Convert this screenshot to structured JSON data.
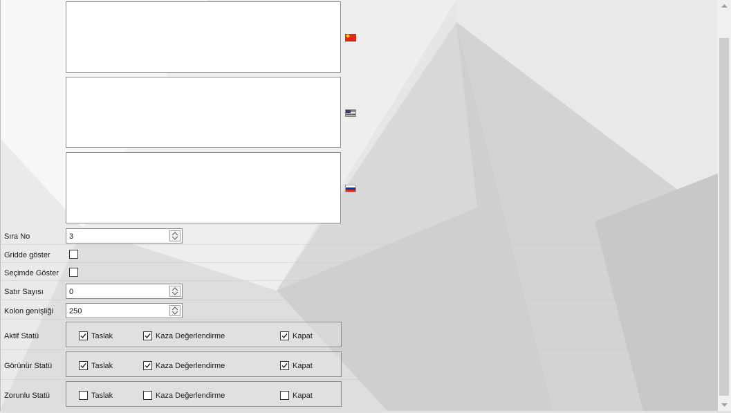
{
  "flags": [
    "china-flag",
    "usa-flag",
    "russia-flag"
  ],
  "fields": {
    "sira_no": {
      "label": "Sıra No",
      "value": "3"
    },
    "gridde_goster": {
      "label": "Gridde göster",
      "checked": false
    },
    "secimde_goster": {
      "label": "Seçimde Göster",
      "checked": false
    },
    "satir_sayisi": {
      "label": "Satır Sayısı",
      "value": "0"
    },
    "kolon_genisligi": {
      "label": "Kolon genişliği",
      "value": "250"
    }
  },
  "status_groups": {
    "aktif": {
      "label": "Aktif Statü",
      "options": [
        {
          "label": "Taslak",
          "checked": true
        },
        {
          "label": "Kaza Değerlendirme",
          "checked": true
        },
        {
          "label": "Kapat",
          "checked": true
        }
      ]
    },
    "gorunur": {
      "label": "Görünür Statü",
      "options": [
        {
          "label": "Taslak",
          "checked": true
        },
        {
          "label": "Kaza Değerlendirme",
          "checked": true
        },
        {
          "label": "Kapat",
          "checked": true
        }
      ]
    },
    "zorunlu": {
      "label": "Zorunlu Statü",
      "options": [
        {
          "label": "Taslak",
          "checked": false
        },
        {
          "label": "Kaza Değerlendirme",
          "checked": false
        },
        {
          "label": "Kapat",
          "checked": false
        }
      ]
    }
  },
  "icons": {
    "spin": "spin-updown-icon",
    "check": "checkmark-icon"
  },
  "colors": {
    "border": "#8c8c8c",
    "background": "#e2e2e2",
    "scroll_thumb": "#cdcdcd"
  }
}
